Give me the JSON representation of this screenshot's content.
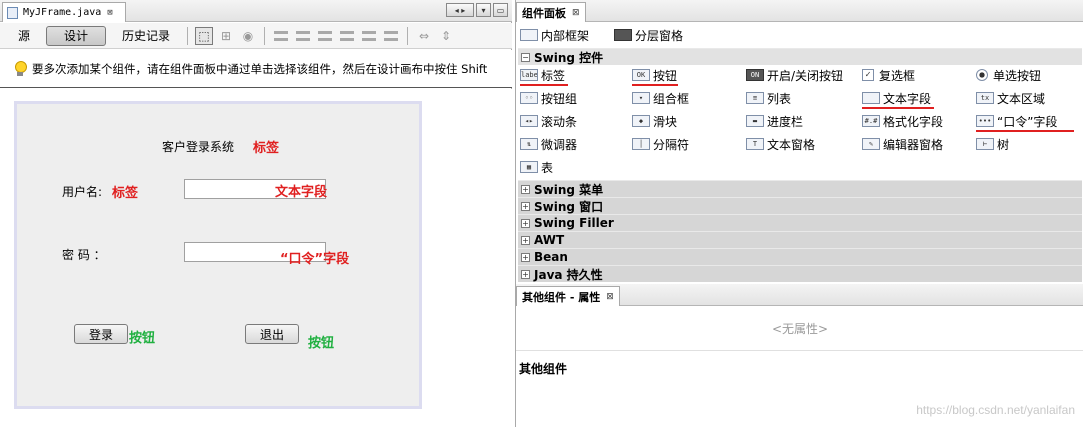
{
  "editor": {
    "tab_label": "MyJFrame.java",
    "close_glyph": "⊠",
    "toolbar": {
      "source": "源",
      "design": "设计",
      "history": "历史记录"
    },
    "hint": "要多次添加某个组件，请在组件面板中通过单击选择该组件，然后在设计画布中按住 Shift",
    "form": {
      "title_text": "客户登录系统",
      "title_note": "标签",
      "user_label": "用户名:",
      "user_note": "标签",
      "user_field_note": "文本字段",
      "pwd_label": "密  码 ：",
      "pwd_field_note": "“口令”字段",
      "login_btn": "登录",
      "login_note": "按钮",
      "exit_btn": "退出",
      "exit_note": "按钮"
    },
    "colors": {
      "annotation_red": "#e02020",
      "annotation_green": "#20b040"
    }
  },
  "palette": {
    "tab_label": "组件面板",
    "top_items": [
      "内部框架",
      "分层窗格"
    ],
    "swing_controls": {
      "header": "Swing 控件",
      "items": [
        "标签",
        "按钮",
        "开启/关闭按钮",
        "复选框",
        "单选按钮",
        "按钮组",
        "组合框",
        "列表",
        "文本字段",
        "文本区域",
        "滚动条",
        "滑块",
        "进度栏",
        "格式化字段",
        "“口令”字段",
        "微调器",
        "分隔符",
        "文本窗格",
        "编辑器窗格",
        "树",
        "表"
      ]
    },
    "categories": [
      "Swing 菜单",
      "Swing 窗口",
      "Swing Filler",
      "AWT",
      "Bean",
      "Java 持久性"
    ]
  },
  "props": {
    "tab_label": "其他组件 - 属性",
    "empty": "<无属性>",
    "section_title": "其他组件"
  },
  "watermark": "https://blog.csdn.net/yanlaifan"
}
